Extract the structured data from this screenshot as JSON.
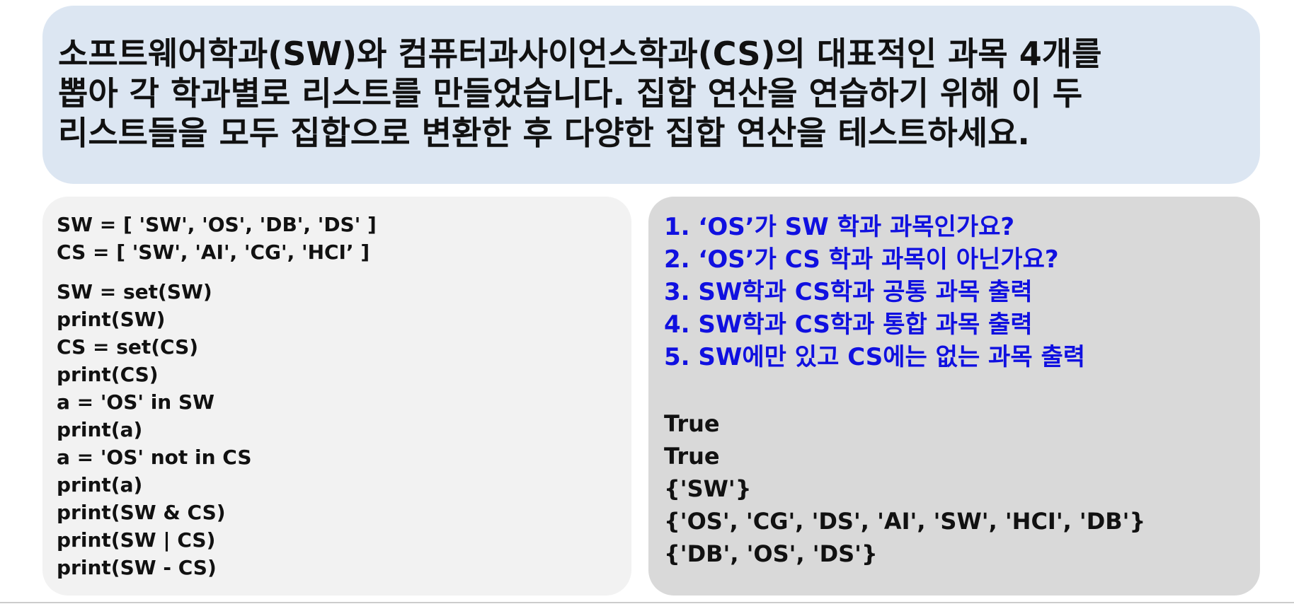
{
  "title": {
    "lines": [
      "소프트웨어학과(SW)와 컴퓨터과사이언스학과(CS)의 대표적인 과목 4개를",
      "뽑아 각 학과별로 리스트를 만들었습니다. 집합 연산을 연습하기 위해 이 두",
      "리스트들을 모두 집합으로 변환한 후 다양한 집합 연산을 테스트하세요."
    ]
  },
  "code": {
    "lists": [
      "SW = [ 'SW', 'OS', 'DB', 'DS' ]",
      "CS = [ 'SW', 'AI', 'CG', 'HCI’ ]"
    ],
    "statements": [
      "SW = set(SW)",
      "print(SW)",
      "CS = set(CS)",
      "print(CS)",
      "a = 'OS' in SW",
      "print(a)",
      "a = 'OS' not in CS",
      "print(a)",
      "print(SW & CS)",
      "print(SW | CS)",
      "print(SW - CS)"
    ]
  },
  "questions": [
    "1. ‘OS’가 SW 학과 과목인가요?",
    "2. ‘OS’가 CS 학과 과목이 아닌가요?",
    "3. SW학과 CS학과 공통 과목 출력",
    "4. SW학과 CS학과 통합 과목 출력",
    "5. SW에만 있고 CS에는 없는 과목 출력"
  ],
  "output": [
    "True",
    "True",
    "{'SW'}",
    "{'OS', 'CG', 'DS', 'AI', 'SW', 'HCI', 'DB'}",
    "{'DB', 'OS', 'DS'}"
  ],
  "colors": {
    "title_bg": "#dce6f2",
    "code_bg": "#f2f2f2",
    "output_bg": "#d9d9d9",
    "question_text": "#1010e0"
  }
}
